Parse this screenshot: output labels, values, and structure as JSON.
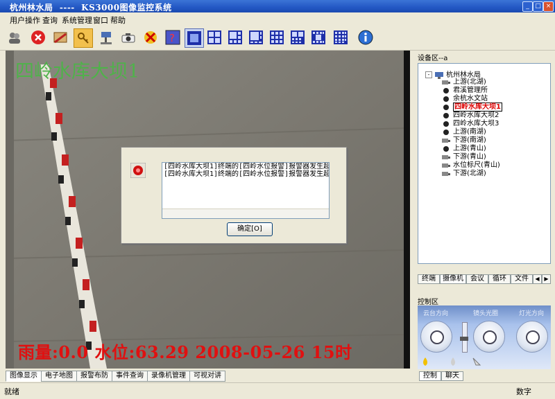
{
  "window": {
    "title": "杭州林水局  ----  KS3000图像监控系统"
  },
  "menu": [
    "用户操作",
    "查询",
    "系统管理",
    "窗口",
    "帮助"
  ],
  "video": {
    "camera_title": "四岭水库大坝1",
    "osd": "雨量:0.0 水位:63.29 2008-05-26 15时"
  },
  "dialog": {
    "lines": [
      "[四岭水库大坝1]终端的[四岭水位报警]报警器发生超",
      "[四岭水库大坝1]终端的[四岭水位报警]报警器发生超"
    ],
    "ok_label": "确定[O]"
  },
  "device_area": {
    "header": "设备区--a",
    "root": "杭州林水局",
    "items": [
      "上游(北湖)",
      "君溪管理所",
      "余杭水文站",
      "四岭水库大坝1",
      "四岭水库大坝2",
      "四岭水库大坝3",
      "上游(南湖)",
      "下游(南湖)",
      "上游(青山)",
      "下游(青山)",
      "水位标尺(青山)",
      "下游(北湖)"
    ],
    "selected": "四岭水库大坝1"
  },
  "side_tabs": [
    "终端",
    "摄像机",
    "会议",
    "循环",
    "文件"
  ],
  "control_area": {
    "header": "控制区",
    "labels": [
      "云台方向",
      "镜头光圈",
      "灯光方向"
    ]
  },
  "control_tabs": [
    "控制",
    "聊天"
  ],
  "bottom_tabs": [
    "图像显示",
    "电子地图",
    "报警布防",
    "事件查询",
    "录像机管理",
    "可视对讲"
  ],
  "status": {
    "left": "就绪",
    "right": "数字"
  }
}
